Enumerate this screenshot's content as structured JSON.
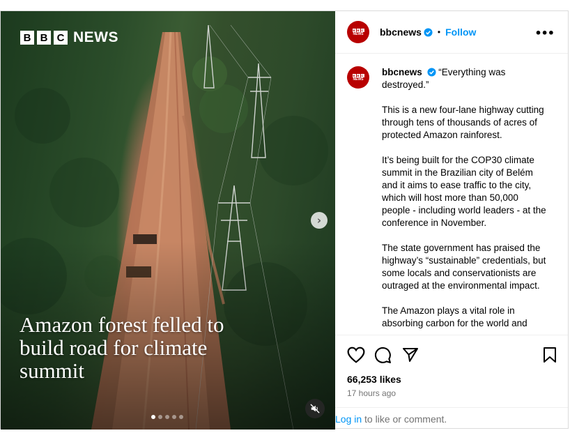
{
  "media": {
    "brand_letters": [
      "B",
      "B",
      "C"
    ],
    "brand_word": "NEWS",
    "headline": "Amazon forest felled to build road for climate summit",
    "carousel_count": 5,
    "carousel_active": 0
  },
  "header": {
    "username": "bbcnews",
    "separator": "•",
    "follow_label": "Follow",
    "more_icon": "more-options-icon"
  },
  "caption": {
    "username": "bbcnews",
    "paragraphs": [
      "“Everything was destroyed.”",
      "This is a new four-lane highway cutting through tens of thousands of acres of protected Amazon rainforest.",
      "It’s being built for the COP30 climate summit in the Brazilian city of Belém and it aims to ease traffic to the city, which will host more than 50,000 people - including world leaders - at the conference in November.",
      "The state government has praised the highway’s “sustainable” credentials, but some locals and conservationists are outraged at the environmental impact.",
      "The Amazon plays a vital role in absorbing carbon for the world and"
    ]
  },
  "engagement": {
    "likes": "66,253 likes",
    "time": "17 hours ago"
  },
  "login": {
    "link": "Log in",
    "rest": " to like or comment."
  },
  "colors": {
    "accent": "#0095f6",
    "bbc_red": "#b80000",
    "verified": "#0095f6"
  }
}
